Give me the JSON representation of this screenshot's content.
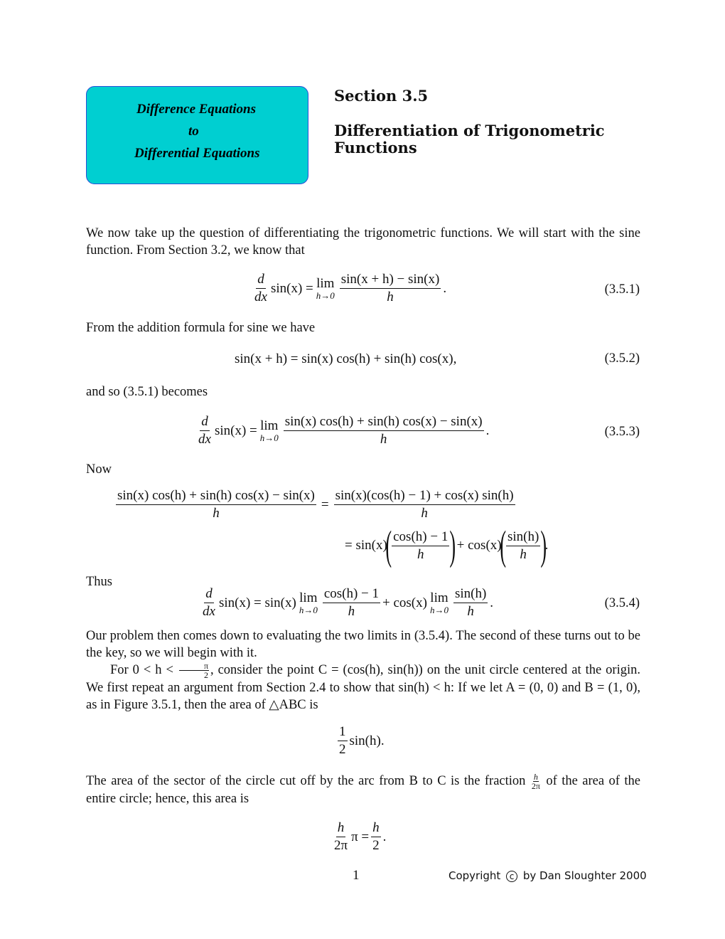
{
  "header_box": {
    "line1": "Difference Equations",
    "line2": "to",
    "line3": "Differential Equations",
    "fill_color": "#00cfd1",
    "border_color": "#2a4fd8"
  },
  "section": {
    "label": "Section 3.5",
    "title_line1": "Differentiation of Trigonometric",
    "title_line2": "Functions"
  },
  "paragraphs": {
    "intro": "We now take up the question of differentiating the trigonometric functions. We will start with the sine function. From Section 3.2, we know that",
    "addition": "From the addition formula for sine we have",
    "becomes": "and so (3.5.1) becomes",
    "now": "Now",
    "thus": "Thus",
    "problem": "Our problem then comes down to evaluating the two limits in (3.5.4). The second of these turns out to be the key, so we will begin with it.",
    "consider_pre": "For 0 < h < ",
    "consider_frac_num": "π",
    "consider_frac_den": "2",
    "consider_post": ", consider the point C = (cos(h), sin(h)) on the unit circle centered at the origin. We first repeat an argument from Section 2.4 to show that sin(h) < h: If we let A = (0, 0) and B = (1, 0), as in Figure 3.5.1, then the area of △ABC is",
    "sector_pre": "The area of the sector of the circle cut off by the arc from B to C is the fraction ",
    "sector_frac_num": "h",
    "sector_frac_den": "2π",
    "sector_post": " of the area of the entire circle; hence, this area is"
  },
  "equations": {
    "eq1": {
      "d": "d",
      "dx": "dx",
      "lhs_fn": "sin(x) =",
      "lim": "lim",
      "lim_sub": "h→0",
      "num": "sin(x + h) − sin(x)",
      "den": "h",
      "end": ".",
      "number": "(3.5.1)"
    },
    "eq2": {
      "text": "sin(x + h) = sin(x) cos(h) + sin(h) cos(x),",
      "number": "(3.5.2)"
    },
    "eq3": {
      "d": "d",
      "dx": "dx",
      "lhs_fn": "sin(x) =",
      "lim": "lim",
      "lim_sub": "h→0",
      "num": "sin(x) cos(h) + sin(h) cos(x) − sin(x)",
      "den": "h",
      "end": ".",
      "number": "(3.5.3)"
    },
    "eq_now": {
      "lhs_num": "sin(x) cos(h) + sin(h) cos(x) − sin(x)",
      "lhs_den": "h",
      "eq": "=",
      "rhs1_num": "sin(x)(cos(h) − 1) + cos(x) sin(h)",
      "rhs1_den": "h",
      "rhs2_pre": "= sin(x)",
      "rhs2_f1_num": "cos(h) − 1",
      "rhs2_f1_den": "h",
      "rhs2_mid": "+ cos(x)",
      "rhs2_f2_num": "sin(h)",
      "rhs2_f2_den": "h",
      "end": "."
    },
    "eq4": {
      "d": "d",
      "dx": "dx",
      "lhs_fn": "sin(x) = sin(x)",
      "lim": "lim",
      "lim_sub": "h→0",
      "f1_num": "cos(h) − 1",
      "f1_den": "h",
      "mid": "+ cos(x)",
      "f2_num": "sin(h)",
      "f2_den": "h",
      "end": ".",
      "number": "(3.5.4)"
    },
    "eq_half": {
      "num": "1",
      "den": "2",
      "text": "sin(h)."
    },
    "eq_sector": {
      "num": "h",
      "den": "2π",
      "mid": "π =",
      "num2": "h",
      "den2": "2",
      "end": "."
    }
  },
  "footer": {
    "page_number": "1",
    "copyright_pre": "Copyright",
    "copyright_symbol": "c",
    "copyright_post": "by Dan Sloughter 2000"
  }
}
